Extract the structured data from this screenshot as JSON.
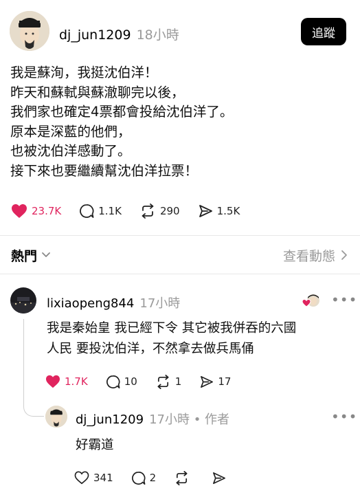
{
  "post": {
    "username": "dj_jun1209",
    "time": "18小時",
    "follow_label": "追蹤",
    "lines": [
      "我是蘇洵，我挺沈伯洋！",
      "昨天和蘇軾與蘇澈聊完以後，",
      "我們家也確定4票都會投給沈伯洋了。",
      "原本是深藍的他們，",
      "也被沈伯洋感動了。",
      "接下來也要繼續幫沈伯洋拉票！"
    ],
    "likes": "23.7K",
    "comments": "1.1K",
    "reposts": "290",
    "shares": "1.5K"
  },
  "sort": {
    "label": "熱門",
    "activity_label": "查看動態"
  },
  "reply1": {
    "username": "lixiaopeng844",
    "time": "17小時",
    "lines": [
      "我是秦始皇 我已經下令 其它被我併吞的六國",
      "人民 要投沈伯洋，不然拿去做兵馬俑"
    ],
    "likes": "1.7K",
    "comments": "10",
    "reposts": "1",
    "shares": "17"
  },
  "reply2": {
    "username": "dj_jun1209",
    "time": "17小時",
    "author_tag": "作者",
    "text": "好霸道",
    "likes": "341",
    "comments": "2"
  },
  "colors": {
    "like_red": "#e0245e",
    "muted_gray": "#9a9a9a",
    "button_black": "#000000"
  }
}
